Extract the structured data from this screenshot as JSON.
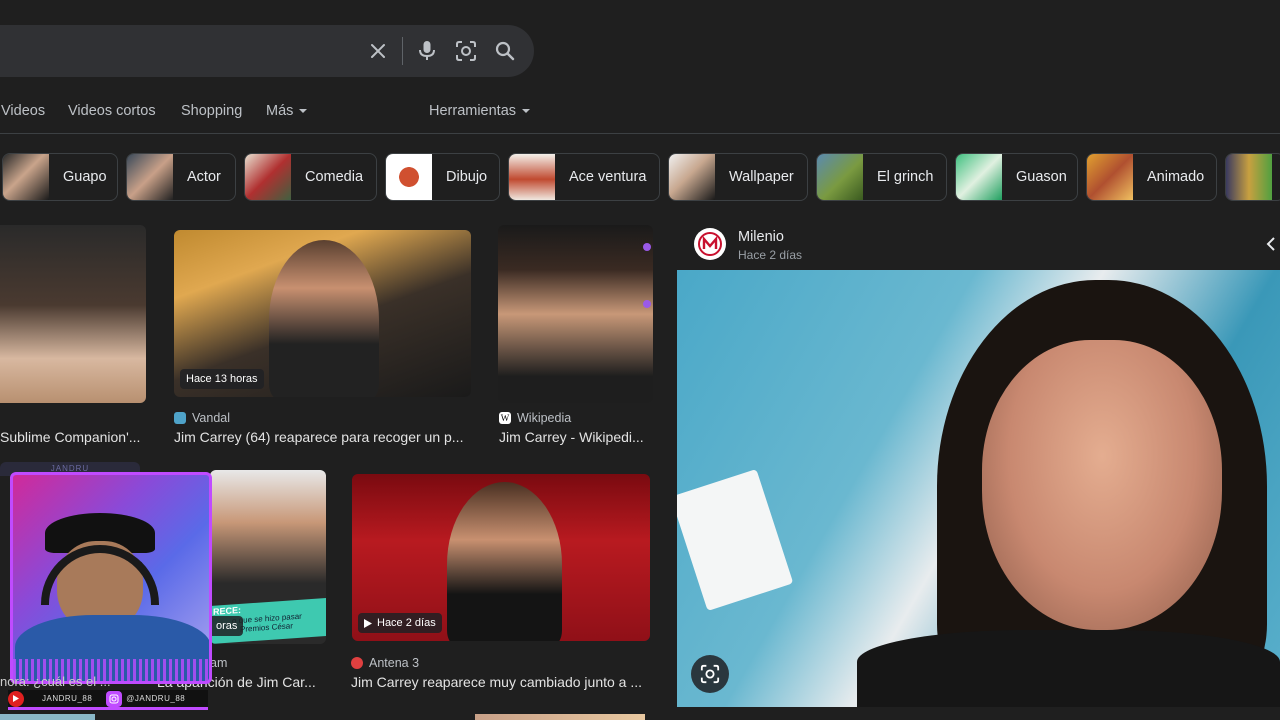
{
  "search": {
    "icons": [
      "close-icon",
      "mic-icon",
      "lens-icon",
      "search-icon"
    ]
  },
  "nav": {
    "videos": "Videos",
    "short_videos": "Videos cortos",
    "shopping": "Shopping",
    "more": "Más",
    "tools": "Herramientas"
  },
  "chips": [
    {
      "label": "Guapo"
    },
    {
      "label": "Actor"
    },
    {
      "label": "Comedia"
    },
    {
      "label": "Dibujo"
    },
    {
      "label": "Ace ventura"
    },
    {
      "label": "Wallpaper"
    },
    {
      "label": "El grinch"
    },
    {
      "label": "Guason"
    },
    {
      "label": "Animado"
    }
  ],
  "results": [
    {
      "source": "",
      "title": "Sublime Companion'...",
      "badge": ""
    },
    {
      "source": "Vandal",
      "title": "Jim Carrey (64) reaparece para recoger un p...",
      "badge": "Hace 13 horas"
    },
    {
      "source": "Wikipedia",
      "title": "Jim Carrey - Wikipedi...",
      "badge": ""
    },
    {
      "source": "am",
      "title": "La aparición de Jim Car...",
      "badge": "oras",
      "caption_line": "RECE:",
      "caption_sub": "o que se hizo pasar",
      "caption_sub2": "Premios César"
    },
    {
      "source": "Antena 3",
      "title": "Jim Carrey reaparece muy cambiado junto a ...",
      "badge": "Hace 2 días"
    }
  ],
  "panel": {
    "source": "Milenio",
    "time": "Hace 2 días"
  },
  "overlay": {
    "channel_top": "JANDRU",
    "youtube_handle": "JANDRU_88",
    "instagram_handle": "@JANDRU_88",
    "ticker": "nora: ¿cuál es el ..."
  },
  "colors": {
    "background": "#1f1f1f",
    "searchbar": "#303134",
    "overlay_accent": "#c04bff"
  }
}
